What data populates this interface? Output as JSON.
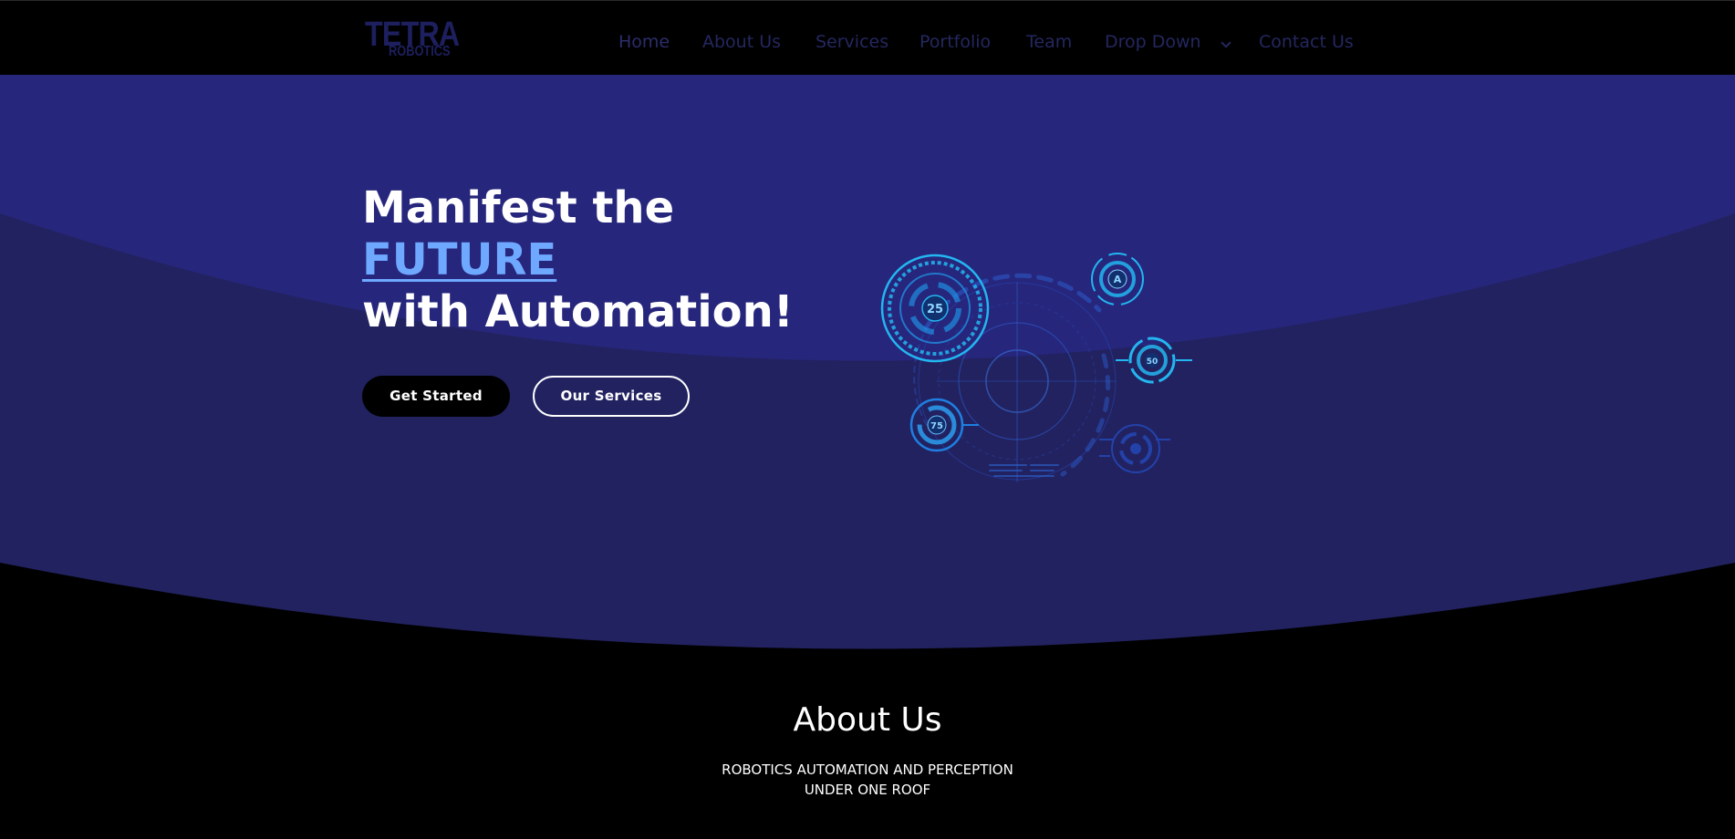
{
  "brand": {
    "logo_top": "TETRA",
    "logo_bottom": "ROBOTICS"
  },
  "nav": {
    "items": [
      {
        "label": "Home",
        "active": true
      },
      {
        "label": "About Us"
      },
      {
        "label": "Services"
      },
      {
        "label": "Portfolio"
      },
      {
        "label": "Team"
      },
      {
        "label": "Drop Down",
        "has_dropdown": true
      },
      {
        "label": "Contact Us"
      }
    ]
  },
  "hero": {
    "title_line1": "Manifest the",
    "title_accent": "FUTURE",
    "title_line3": "with Automation!",
    "primary_button": "Get Started",
    "secondary_button": "Our Services",
    "gauges": {
      "large": "25",
      "top_right": "A",
      "right": "50",
      "lower_left": "75"
    }
  },
  "about": {
    "title": "About Us",
    "subtitle_line1": "ROBOTICS AUTOMATION AND PERCEPTION",
    "subtitle_line2": "UNDER ONE ROOF"
  },
  "colors": {
    "page_bg": "#000000",
    "hero_light": "#26267c",
    "hero_dark": "#222261",
    "accent": "#6ea8ff",
    "nav_text": "#24275f",
    "hud_cyan": "#23b6f0",
    "hud_blue": "#1f5fd6"
  }
}
